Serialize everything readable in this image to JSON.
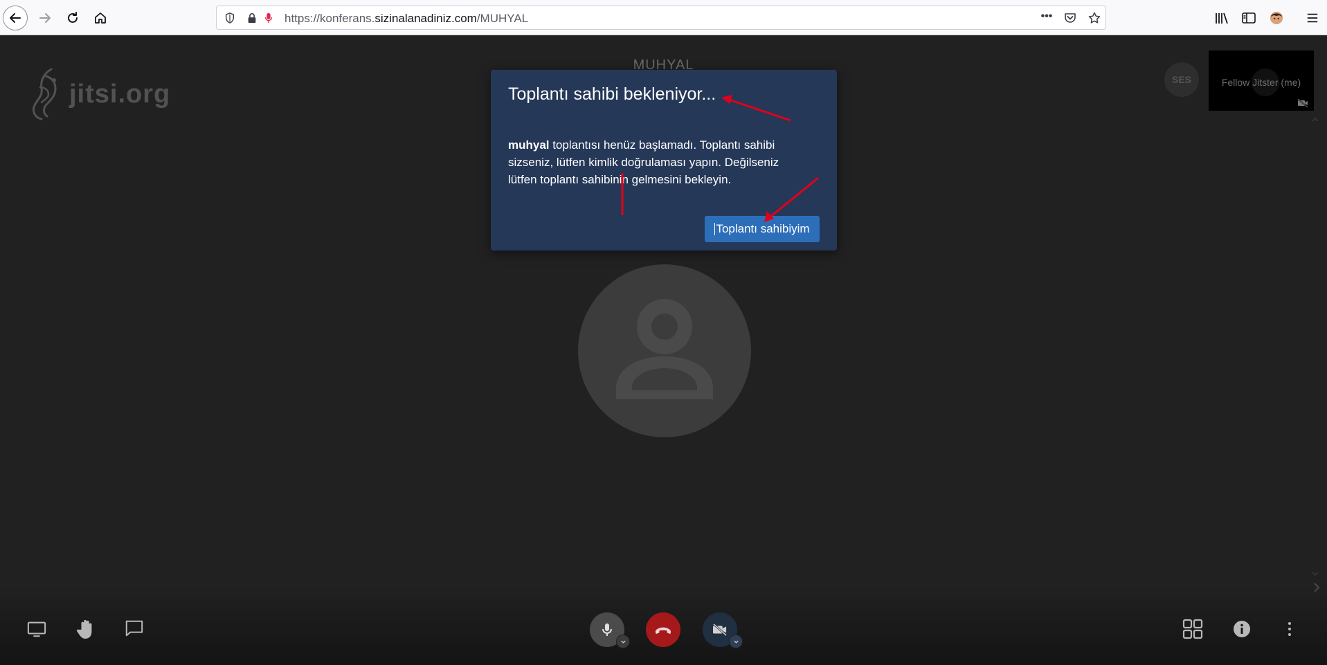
{
  "browser": {
    "url_prefix": "https://konferans.",
    "url_domain": "sizinalanadiniz.com",
    "url_path": "/MUHYAL",
    "page_actions_label": "•••"
  },
  "app": {
    "logo_text": "jitsi.org",
    "room_title": "MUHYAL",
    "ses_avatar_initials": "SES",
    "local_participant_name": "Fellow Jitster (me)"
  },
  "dialog": {
    "title": "Toplantı sahibi bekleniyor...",
    "body_bold": "muhyal",
    "body_text": " toplantısı henüz başlamadı. Toplantı sahibi sizseniz, lütfen kimlik doğrulaması yapın. Değilseniz lütfen toplantı sahibinin gelmesini bekleyin.",
    "button_label": "Toplantı sahibiyim"
  },
  "colors": {
    "dialog_bg": "#253858",
    "button_bg": "#2d6eb9",
    "hangup_bg": "#a5191a",
    "annotation_red": "#e3001b"
  },
  "icons": {
    "toolbar_left": [
      "screenshare-icon",
      "raise-hand-icon",
      "chat-icon"
    ],
    "toolbar_center": [
      "microphone-icon",
      "hangup-icon",
      "camera-off-icon"
    ],
    "toolbar_right": [
      "tile-view-icon",
      "info-icon",
      "more-options-icon"
    ]
  }
}
